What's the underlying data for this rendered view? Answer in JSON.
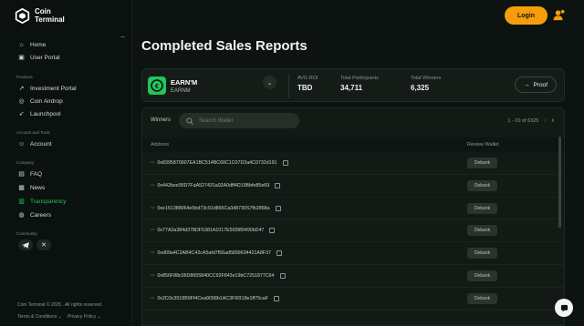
{
  "app": {
    "logo_line1": "Coin",
    "logo_line2": "Terminal"
  },
  "sidebar": {
    "collapse_glyph": "←",
    "top_items": [
      {
        "label": "Home",
        "icon": "home-icon"
      },
      {
        "label": "User Portal",
        "icon": "portal-icon"
      }
    ],
    "products_title": "Products",
    "products": [
      {
        "label": "Investment Portal",
        "icon": "chart-icon"
      },
      {
        "label": "Coin Airdrop",
        "icon": "coin-icon"
      },
      {
        "label": "Launchpool",
        "icon": "rocket-icon"
      }
    ],
    "account_title": "Account and Tools",
    "account": [
      {
        "label": "Account",
        "icon": "user-icon"
      }
    ],
    "company_title": "Company",
    "company": [
      {
        "label": "FAQ",
        "icon": "faq-icon"
      },
      {
        "label": "News",
        "icon": "news-icon"
      },
      {
        "label": "Transparency",
        "icon": "transparency-icon",
        "active": true
      },
      {
        "label": "Careers",
        "icon": "careers-icon"
      }
    ],
    "community_title": "Community",
    "footer_copy": "Coin Terminal © 2025 . All rights reserved.",
    "footer_terms": "Terms & Conditions",
    "footer_privacy": "Privacy Policy"
  },
  "header": {
    "login_label": "Login"
  },
  "page": {
    "title": "Completed Sales Reports"
  },
  "summary": {
    "token_name": "EARN'M",
    "token_symbol": "EARNM",
    "avg_roi_label": "AVG ROI",
    "avg_roi_value": "TBD",
    "participants_label": "Total Participants",
    "participants_value": "34,711",
    "winners_label": "Total Winners",
    "winners_value": "6,325",
    "proof_label": "Proof"
  },
  "winners": {
    "label": "Winners",
    "search_placeholder": "Search Wallet",
    "range_text": "1 - 20 of 6325",
    "col_address": "Address",
    "col_review": "Review Wallet",
    "rows": [
      {
        "address": "0x8395870007EA1BC514BC60C1C07D3a4C0732d191",
        "action": "Debank"
      },
      {
        "address": "0x442bee95D7FaA527431a02A0dff4D19Bbfe85e69",
        "action": "Debank"
      },
      {
        "address": "0xe161388064e5bd73c91d865Ca3d8730S7fb2868a",
        "action": "Debank"
      },
      {
        "address": "0x77A2a384d378DF5381A1017E5f2889490bD47",
        "action": "Debank"
      },
      {
        "address": "0xd09a4C2AB4C42cA5afd7f56ad5899634421A8F37",
        "action": "Debank"
      },
      {
        "address": "0x856F88c06D8655840CC92F843e19bC7251877C64",
        "action": "Debank"
      },
      {
        "address": "0x2D3c3518B9Ff4Cea9098b1AC3F6f318e1ff75caF",
        "action": "Debank"
      }
    ]
  },
  "colors": {
    "accent": "#22c55e",
    "login": "#f59e0b",
    "background": "#0d1310"
  }
}
